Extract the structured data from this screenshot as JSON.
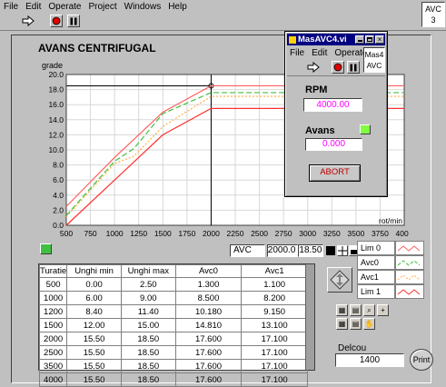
{
  "menu": [
    "File",
    "Edit",
    "Operate",
    "Project",
    "Windows",
    "Help"
  ],
  "corner_badge": [
    "AVC",
    "3"
  ],
  "chart_data": {
    "type": "line",
    "title": "AVANS CENTRIFUGAL",
    "ylabel": "grade",
    "xlabel": "rot/min",
    "xlim": [
      500,
      4000
    ],
    "ylim": [
      0,
      20
    ],
    "x_ticks": [
      500,
      750,
      1000,
      1250,
      1500,
      1750,
      2000,
      2250,
      2500,
      2750,
      3000,
      3250,
      3500,
      3750,
      4000
    ],
    "y_ticks": [
      "0.0",
      "2.0",
      "4.0",
      "6.0",
      "8.0",
      "10.0",
      "12.0",
      "14.0",
      "16.0",
      "18.0",
      "20.0"
    ],
    "grid": true,
    "cursor_x": 2000,
    "x": [
      500,
      1000,
      1200,
      1500,
      2000,
      2500,
      3000,
      3500,
      4000
    ],
    "series": [
      {
        "name": "Lim 0",
        "color": "#ff6060",
        "dash": "",
        "values": [
          2.5,
          9.0,
          11.4,
          15.0,
          18.5,
          18.5,
          18.5,
          18.5,
          18.5
        ]
      },
      {
        "name": "Avc0",
        "color": "#40c040",
        "dash": "6,3",
        "values": [
          1.3,
          8.5,
          10.18,
          14.81,
          17.6,
          17.6,
          17.6,
          17.6,
          17.6
        ]
      },
      {
        "name": "Avc1",
        "color": "#ffb040",
        "dash": "2,2",
        "values": [
          1.1,
          8.2,
          9.15,
          13.1,
          17.1,
          17.1,
          17.1,
          17.1,
          17.1
        ]
      },
      {
        "name": "Lim 1",
        "color": "#ff3030",
        "dash": "",
        "values": [
          0.0,
          6.0,
          8.4,
          12.0,
          15.5,
          15.5,
          15.5,
          15.5,
          15.5
        ]
      }
    ]
  },
  "cursor_box": {
    "name": "AVC",
    "x": "2000.0",
    "y": "18.50"
  },
  "table": {
    "headers": [
      "Turatie",
      "Unghi min",
      "Unghi max",
      "Avc0",
      "Avc1"
    ],
    "rows": [
      [
        "500",
        "0.00",
        "2.50",
        "1.300",
        "1.100"
      ],
      [
        "1000",
        "6.00",
        "9.00",
        "8.500",
        "8.200"
      ],
      [
        "1200",
        "8.40",
        "11.40",
        "10.180",
        "9.150"
      ],
      [
        "1500",
        "12.00",
        "15.00",
        "14.810",
        "13.100"
      ],
      [
        "2000",
        "15.50",
        "18.50",
        "17.600",
        "17.100"
      ],
      [
        "2500",
        "15.50",
        "18.50",
        "17.600",
        "17.100"
      ],
      [
        "3500",
        "15.50",
        "18.50",
        "17.600",
        "17.100"
      ],
      [
        "4000",
        "15.50",
        "18.50",
        "17.600",
        "17.100"
      ]
    ]
  },
  "legend": [
    "Lim 0",
    "Avc0",
    "Avc1",
    "Lim 1"
  ],
  "delcou": {
    "label": "Delcou",
    "value": "1400"
  },
  "print_label": "Print",
  "popup": {
    "title": "MasAVC4.vi",
    "menu": [
      "File",
      "Edit",
      "Operate"
    ],
    "badge": [
      "Mas4",
      "AVC"
    ],
    "rpm_label": "RPM",
    "rpm_value": "4000.00",
    "avans_label": "Avans",
    "avans_value": "0.000",
    "abort_label": "ABORT",
    "colors": {
      "title_bar": "#000080",
      "value_text": "#ff00ff",
      "abort_text": "#c00000",
      "led": "#80ff40"
    }
  }
}
